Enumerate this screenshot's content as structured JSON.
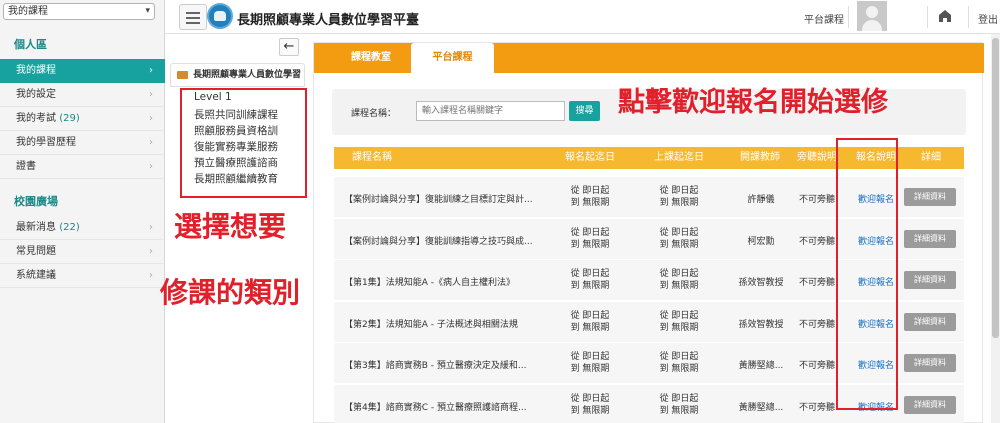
{
  "sidebar": {
    "course_select": "我的課程",
    "section_personal": "個人區",
    "items_personal": [
      {
        "label": "我的課程",
        "count": ""
      },
      {
        "label": "我的設定",
        "count": ""
      },
      {
        "label": "我的考試",
        "count": "(29)"
      },
      {
        "label": "我的學習歷程",
        "count": ""
      },
      {
        "label": "證書",
        "count": ""
      }
    ],
    "section_campus": "校園廣場",
    "items_campus": [
      {
        "label": "最新消息",
        "count": "(22)"
      },
      {
        "label": "常見問題",
        "count": ""
      },
      {
        "label": "系統建議",
        "count": ""
      }
    ]
  },
  "header": {
    "title": "長期照顧專業人員數位學習平臺",
    "platform_courses": "平台課程",
    "logout": "登出",
    "icons": [
      "menu-icon",
      "logo-icon",
      "avatar-icon",
      "home-icon"
    ]
  },
  "tree": {
    "header": "長期照顧專業人員數位學習",
    "items": [
      "Level 1",
      "長照共同訓練課程",
      "照顧服務員資格訓",
      "復能實務專業服務",
      "預立醫療照護諮商",
      "長期照顧繼續教育"
    ]
  },
  "tabs": [
    "課程教室",
    "平台課程"
  ],
  "search": {
    "label": "課程名稱：",
    "placeholder": "輸入課程名稱關鍵字",
    "button": "搜尋"
  },
  "table": {
    "headers": [
      "課程名稱",
      "報名起迄日",
      "上課起迄日",
      "開課教師",
      "旁聽說明",
      "報名說明",
      "詳細"
    ],
    "rows": [
      {
        "name": "【案例討論與分享】復能訓練之目標訂定與計...",
        "enroll_from": "從 即日起",
        "enroll_to": "到 無限期",
        "class_from": "從 即日起",
        "class_to": "到 無限期",
        "teacher": "許靜儀",
        "audit": "不可旁聽",
        "enroll": "歡迎報名",
        "detail": "詳細資料"
      },
      {
        "name": "【案例討論與分享】復能訓練指導之技巧與成...",
        "enroll_from": "從 即日起",
        "enroll_to": "到 無限期",
        "class_from": "從 即日起",
        "class_to": "到 無限期",
        "teacher": "柯宏勳",
        "audit": "不可旁聽",
        "enroll": "歡迎報名",
        "detail": "詳細資料"
      },
      {
        "name": "【第1集】法規知能A -《病人自主權利法》",
        "enroll_from": "從 即日起",
        "enroll_to": "到 無限期",
        "class_from": "從 即日起",
        "class_to": "到 無限期",
        "teacher": "孫效智教授",
        "audit": "不可旁聽",
        "enroll": "歡迎報名",
        "detail": "詳細資料"
      },
      {
        "name": "【第2集】法規知能A - 子法概述與相關法規",
        "enroll_from": "從 即日起",
        "enroll_to": "到 無限期",
        "class_from": "從 即日起",
        "class_to": "到 無限期",
        "teacher": "孫效智教授",
        "audit": "不可旁聽",
        "enroll": "歡迎報名",
        "detail": "詳細資料"
      },
      {
        "name": "【第3集】諮商實務B - 預立醫療決定及緩和...",
        "enroll_from": "從 即日起",
        "enroll_to": "到 無限期",
        "class_from": "從 即日起",
        "class_to": "到 無限期",
        "teacher": "黃勝堅總...",
        "audit": "不可旁聽",
        "enroll": "歡迎報名",
        "detail": "詳細資料"
      },
      {
        "name": "【第4集】諮商實務C - 預立醫療照護諮商程...",
        "enroll_from": "從 即日起",
        "enroll_to": "到 無限期",
        "class_from": "從 即日起",
        "class_to": "到 無限期",
        "teacher": "黃勝堅總...",
        "audit": "不可旁聽",
        "enroll": "歡迎報名",
        "detail": "詳細資料"
      }
    ]
  },
  "annotations": {
    "top_right": "點擊歡迎報名開始選修",
    "left_line1": "選擇想要",
    "left_line2": "修課的類別"
  },
  "colors": {
    "accent_teal": "#17a2a0",
    "tab_orange": "#f39c12",
    "header_yellow": "#f5b82e",
    "annotation_red": "#e0202a",
    "link_blue": "#1a6fc2"
  }
}
